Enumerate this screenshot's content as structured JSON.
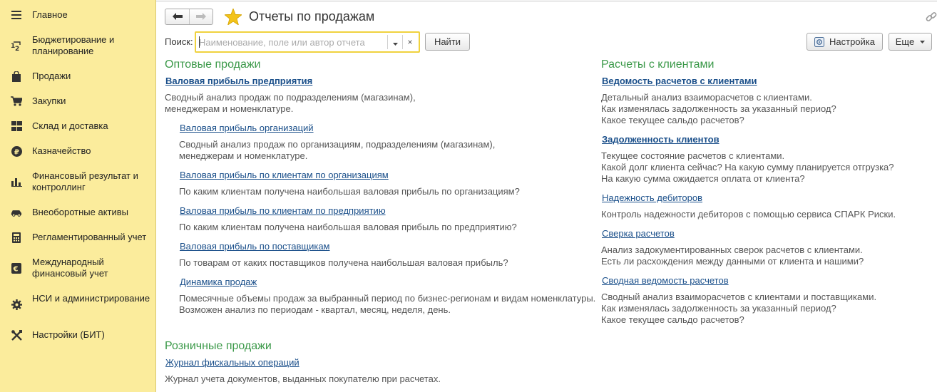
{
  "sidebar": {
    "items": [
      {
        "label": "Главное",
        "icon": "menu-lines-icon"
      },
      {
        "label": "Бюджетирование и планирование",
        "icon": "budget-icon"
      },
      {
        "label": "Продажи",
        "icon": "shopping-bag-icon"
      },
      {
        "label": "Закупки",
        "icon": "cart-icon"
      },
      {
        "label": "Склад и доставка",
        "icon": "grid-icon"
      },
      {
        "label": "Казначейство",
        "icon": "ruble-coin-icon"
      },
      {
        "label": "Финансовый результат и контроллинг",
        "icon": "bar-chart-icon"
      },
      {
        "label": "Внеоборотные активы",
        "icon": "car-icon"
      },
      {
        "label": "Регламентированный учет",
        "icon": "calculator-icon"
      },
      {
        "label": "Международный финансовый учет",
        "icon": "euro-icon"
      },
      {
        "label": "НСИ и администрирование",
        "icon": "gear-icon"
      },
      {
        "label": "Настройки (БИТ)",
        "icon": "tools-icon"
      }
    ]
  },
  "header": {
    "title": "Отчеты по продажам",
    "back_icon": "arrow-left-icon",
    "forward_icon": "arrow-right-icon",
    "favorite_icon": "star-icon",
    "link_icon": "link-icon"
  },
  "search": {
    "label": "Поиск:",
    "placeholder": "Наименование, поле или автор отчета",
    "value": "",
    "clear": "×",
    "find_button": "Найти"
  },
  "toolbar": {
    "settings_button": "Настройка",
    "more_button": "Еще"
  },
  "colors": {
    "sidebar_bg": "#fbec9c",
    "section_title": "#3b9949",
    "link": "#1a4f8a",
    "search_border": "#f0d23e",
    "star": "#f3c31a"
  },
  "sections": {
    "wholesale": {
      "title": "Оптовые продажи",
      "reports": [
        {
          "name": "Валовая прибыль предприятия",
          "desc1": "Сводный анализ продаж по подразделениям (магазинам),",
          "desc2": "менеджерам и номенклатуре."
        },
        {
          "name": "Валовая прибыль организаций",
          "desc1": "Сводный анализ продаж по организациям, подразделениям (магазинам),",
          "desc2": "менеджерам и номенклатуре."
        },
        {
          "name": "Валовая прибыль по клиентам по организациям",
          "desc1": "По каким клиентам получена наибольшая валовая прибыль по организациям?"
        },
        {
          "name": "Валовая прибыль по клиентам по предприятию",
          "desc1": "По каким клиентам получена наибольшая валовая прибыль по предприятию?"
        },
        {
          "name": "Валовая прибыль по поставщикам",
          "desc1": "По товарам от каких поставщиков получена наибольшая валовая прибыль?"
        },
        {
          "name": "Динамика продаж",
          "desc1": "Помесячные объемы продаж за выбранный период по бизнес-регионам и видам номенклатуры.",
          "desc2": "Возможен анализ по периодам - квартал, месяц, неделя, день."
        }
      ]
    },
    "retail": {
      "title": "Розничные продажи",
      "reports": [
        {
          "name": "Журнал фискальных операций",
          "desc1": "Журнал учета документов, выданных покупателю при расчетах."
        }
      ]
    },
    "clients": {
      "title": "Расчеты с клиентами",
      "reports": [
        {
          "name": "Ведомость расчетов с клиентами",
          "desc1": "Детальный анализ взаиморасчетов с клиентами.",
          "desc2": "Как изменялась задолженность за указанный период?",
          "desc3": "Какое текущее сальдо расчетов?"
        },
        {
          "name": "Задолженность клиентов",
          "desc1": "Текущее состояние расчетов с клиентами.",
          "desc2": "Какой долг клиента сейчас? На какую сумму планируется отгрузка?",
          "desc3": "На какую сумма ожидается оплата от клиента?"
        },
        {
          "name": "Надежность дебиторов",
          "desc1": "Контроль надежности дебиторов с помощью сервиса СПАРК Риски."
        },
        {
          "name": "Сверка расчетов",
          "desc1": "Анализ задокументированных сверок расчетов с клиентами.",
          "desc2": "Есть ли расхождения между данными от клиента и нашими?"
        },
        {
          "name": "Сводная ведомость расчетов",
          "desc1": "Сводный анализ взаиморасчетов с клиентами и поставщиками.",
          "desc2": "Как изменялась задолженность за указанный период?",
          "desc3": "Какое текущее сальдо расчетов?"
        }
      ]
    }
  }
}
